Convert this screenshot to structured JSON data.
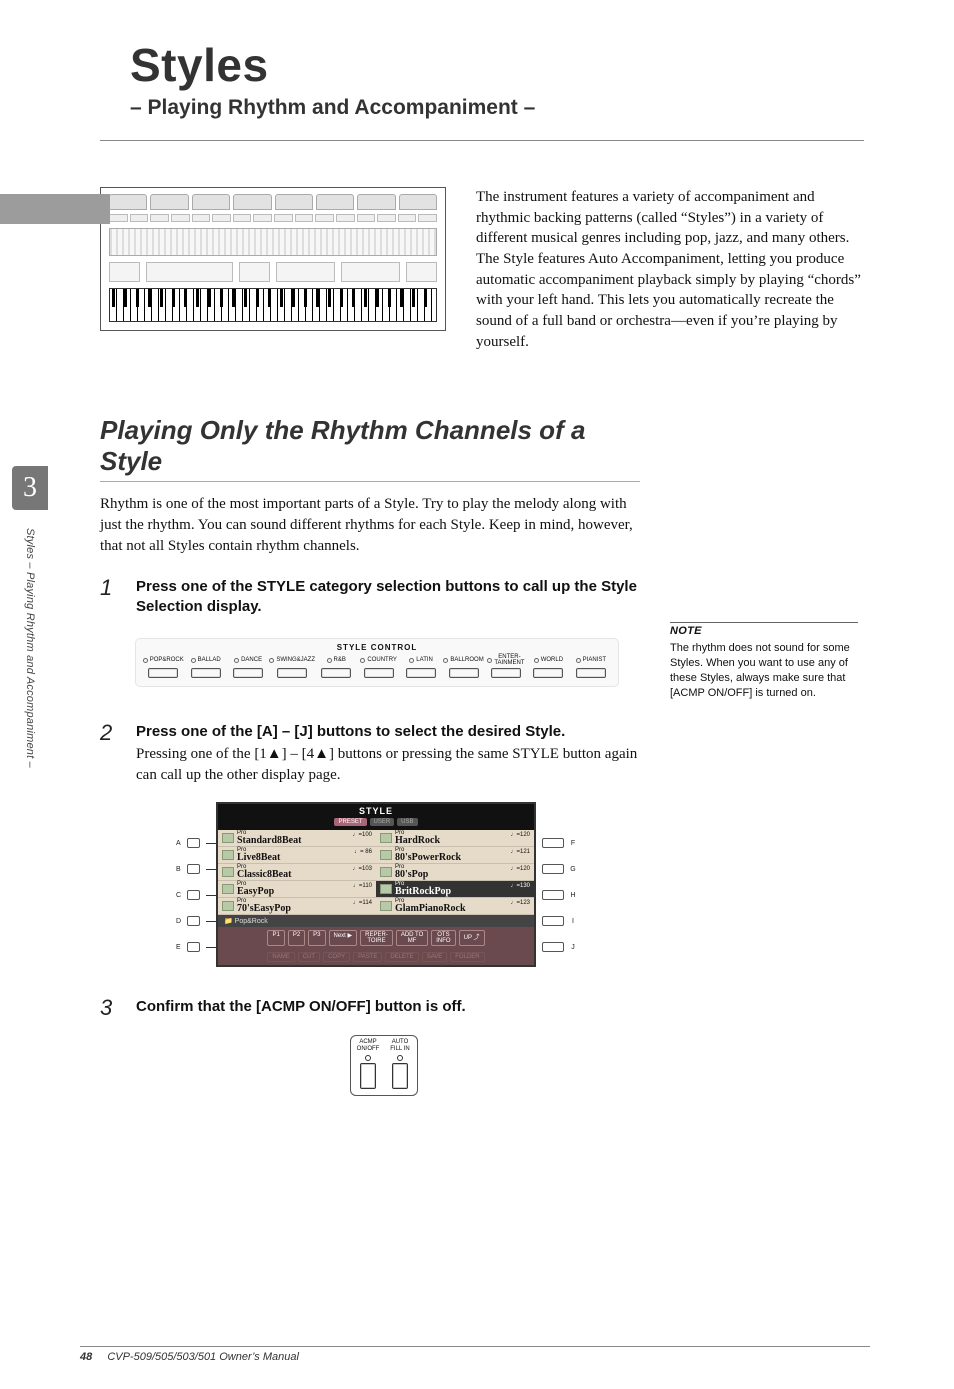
{
  "side_tab": "3",
  "side_text": "Styles – Playing Rhythm and Accompaniment –",
  "chapter_title": "Styles",
  "chapter_subtitle": "– Playing Rhythm and Accompaniment –",
  "intro_text": "The instrument features a variety of accompaniment and rhythmic backing patterns (called “Styles”) in a variety of different musical genres including pop, jazz, and many others. The Style features Auto Accompaniment, letting you produce automatic accompaniment playback simply by playing “chords” with your left hand. This lets you automatically recreate the sound of a full band or orchestra—even if you’re playing by yourself.",
  "section_title": "Playing Only the Rhythm Channels of a Style",
  "section_para": "Rhythm is one of the most important parts of a Style. Try to play the melody along with just the rhythm. You can sound different rhythms for each Style. Keep in mind, however, that not all Styles contain rhythm channels.",
  "step1": {
    "title": "Press one of the STYLE category selection buttons to call up the Style Selection display."
  },
  "step2": {
    "title": "Press one of the [A] – [J] buttons to select the desired Style.",
    "desc": "Pressing one of the [1▲] – [4▲] buttons or pressing the same STYLE button again can call up the other display page."
  },
  "step3": {
    "title": "Confirm that the [ACMP ON/OFF] button is off."
  },
  "style_control": {
    "title": "STYLE  CONTROL",
    "items": [
      "POP&ROCK",
      "BALLAD",
      "DANCE",
      "SWING&JAZZ",
      "R&B",
      "COUNTRY",
      "LATIN",
      "BALLROOM",
      "ENTER-\nTAINMENT",
      "WORLD",
      "PIANIST"
    ]
  },
  "style_screen": {
    "title": "STYLE",
    "tabs": [
      "PRESET",
      "USER",
      "USB"
    ],
    "left": [
      {
        "letter": "A",
        "pre": "Pro",
        "name": "Standard8Beat",
        "tempo": "♩=100"
      },
      {
        "letter": "B",
        "pre": "Pro",
        "name": "Live8Beat",
        "tempo": "♩= 86"
      },
      {
        "letter": "C",
        "pre": "Pro",
        "name": "Classic8Beat",
        "tempo": "♩=103"
      },
      {
        "letter": "D",
        "pre": "Pro",
        "name": "EasyPop",
        "tempo": "♩=110"
      },
      {
        "letter": "E",
        "pre": "Pro",
        "name": "70'sEasyPop",
        "tempo": "♩=114"
      }
    ],
    "right": [
      {
        "letter": "F",
        "pre": "Pro",
        "name": "HardRock",
        "tempo": "♩=120"
      },
      {
        "letter": "G",
        "pre": "Pro",
        "name": "80'sPowerRock",
        "tempo": "♩=121"
      },
      {
        "letter": "H",
        "pre": "Pro",
        "name": "80'sPop",
        "tempo": "♩=120"
      },
      {
        "letter": "I",
        "pre": "Pro",
        "name": "BritRockPop",
        "tempo": "♩=130",
        "selected": true
      },
      {
        "letter": "J",
        "pre": "Pro",
        "name": "GlamPianoRock",
        "tempo": "♩=123"
      }
    ],
    "folder": "Pop&Rock",
    "bottom_row1": [
      "P1",
      "P2",
      "P3",
      "Next ▶",
      "REPER-\nTOIRE",
      "ADD TO\nMF",
      "OTS\nINFO",
      "UP ⤴"
    ],
    "bottom_row2": [
      "NAME",
      "CUT",
      "COPY",
      "PASTE",
      "DELETE",
      "SAVE",
      "FOLDER"
    ]
  },
  "acmp": {
    "left": "ACMP\nON/OFF",
    "right": "AUTO\nFILL IN"
  },
  "note": {
    "label": "NOTE",
    "body": "The rhythm does not sound for some Styles. When you want to use any of these Styles, always make sure that [ACMP ON/OFF] is turned on."
  },
  "footer_page": "48",
  "footer_text": "CVP-509/505/503/501 Owner’s Manual"
}
